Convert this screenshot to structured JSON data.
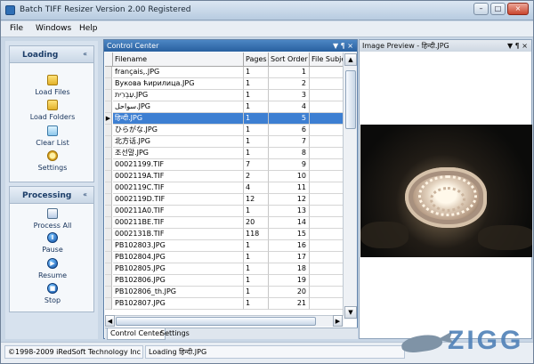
{
  "window": {
    "title": "Batch TIFF Resizer Version 2.00 Registered",
    "buttons": {
      "minimize": "–",
      "maximize": "□",
      "close": "×"
    }
  },
  "menu": [
    "File",
    "Windows",
    "Help"
  ],
  "sidebar": {
    "loading": {
      "title": "Loading",
      "collapse_icon": "«",
      "items": [
        {
          "label": "Load Files",
          "icon": "folder-open-icon"
        },
        {
          "label": "Load Folders",
          "icon": "folder-stack-icon"
        },
        {
          "label": "Clear List",
          "icon": "clear-list-icon"
        },
        {
          "label": "Settings",
          "icon": "gear-icon"
        }
      ]
    },
    "processing": {
      "title": "Processing",
      "collapse_icon": "«",
      "items": [
        {
          "label": "Process All",
          "icon": "process-all-icon"
        },
        {
          "label": "Pause",
          "icon": "pause-icon",
          "glyph": "Ⅱ"
        },
        {
          "label": "Resume",
          "icon": "play-icon",
          "glyph": "▶"
        },
        {
          "label": "Stop",
          "icon": "stop-icon",
          "glyph": "■"
        }
      ]
    }
  },
  "control_center": {
    "title": "Control Center",
    "pane_buttons": "▼ ¶ ×",
    "columns": [
      "Filename",
      "Pages",
      "Sort Order",
      "File Subject"
    ],
    "rows": [
      {
        "filename": "français,.JPG",
        "pages": "1",
        "sort_order": "1"
      },
      {
        "filename": "Вукова ћирилица.JPG",
        "pages": "1",
        "sort_order": "2"
      },
      {
        "filename": "עִבְרִית.JPG",
        "pages": "1",
        "sort_order": "3"
      },
      {
        "filename": "سواحل.JPG",
        "pages": "1",
        "sort_order": "4"
      },
      {
        "filename": "हिन्दी.JPG",
        "pages": "1",
        "sort_order": "5",
        "selected": true
      },
      {
        "filename": "ひらがな.JPG",
        "pages": "1",
        "sort_order": "6"
      },
      {
        "filename": "北方话.JPG",
        "pages": "1",
        "sort_order": "7"
      },
      {
        "filename": "조선말.JPG",
        "pages": "1",
        "sort_order": "8"
      },
      {
        "filename": "00021199.TIF",
        "pages": "7",
        "sort_order": "9"
      },
      {
        "filename": "0002119A.TIF",
        "pages": "2",
        "sort_order": "10"
      },
      {
        "filename": "0002119C.TIF",
        "pages": "4",
        "sort_order": "11"
      },
      {
        "filename": "0002119D.TIF",
        "pages": "12",
        "sort_order": "12"
      },
      {
        "filename": "000211A0.TIF",
        "pages": "1",
        "sort_order": "13"
      },
      {
        "filename": "000211BE.TIF",
        "pages": "20",
        "sort_order": "14"
      },
      {
        "filename": "0002131B.TIF",
        "pages": "118",
        "sort_order": "15"
      },
      {
        "filename": "PB102803.JPG",
        "pages": "1",
        "sort_order": "16"
      },
      {
        "filename": "PB102804.JPG",
        "pages": "1",
        "sort_order": "17"
      },
      {
        "filename": "PB102805.JPG",
        "pages": "1",
        "sort_order": "18"
      },
      {
        "filename": "PB102806.JPG",
        "pages": "1",
        "sort_order": "19"
      },
      {
        "filename": "PB102806_th.JPG",
        "pages": "1",
        "sort_order": "20"
      },
      {
        "filename": "PB102807.JPG",
        "pages": "1",
        "sort_order": "21"
      }
    ],
    "tabs": [
      "Control Center",
      "Settings"
    ]
  },
  "preview": {
    "title": "Image Preview - हिन्दी.JPG",
    "pane_buttons": "▼ ¶ ×"
  },
  "status": {
    "copyright": "©1998-2009 iRedSoft Technology Inc",
    "message": "Loading हिन्दी.JPG"
  },
  "watermark": {
    "text": "ZIGG"
  }
}
